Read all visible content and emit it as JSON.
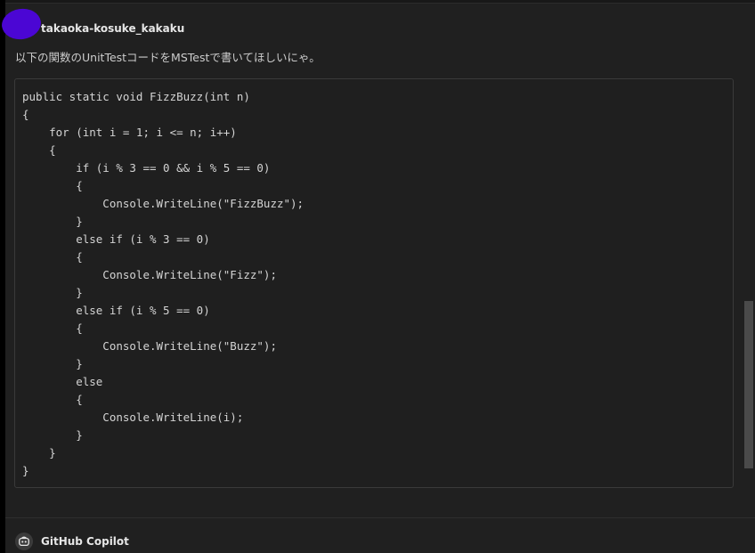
{
  "chat": {
    "user": {
      "name": "takaoka-kosuke_kakaku",
      "message": "以下の関数のUnitTestコードをMSTestで書いてほしいにゃ。",
      "avatar_color": "#4b06d4"
    },
    "code": "public static void FizzBuzz(int n)\n{\n    for (int i = 1; i <= n; i++)\n    {\n        if (i % 3 == 0 && i % 5 == 0)\n        {\n            Console.WriteLine(\"FizzBuzz\");\n        }\n        else if (i % 3 == 0)\n        {\n            Console.WriteLine(\"Fizz\");\n        }\n        else if (i % 5 == 0)\n        {\n            Console.WriteLine(\"Buzz\");\n        }\n        else\n        {\n            Console.WriteLine(i);\n        }\n    }\n}",
    "assistant": {
      "name": "GitHub Copilot",
      "icon": "copilot-icon"
    }
  }
}
